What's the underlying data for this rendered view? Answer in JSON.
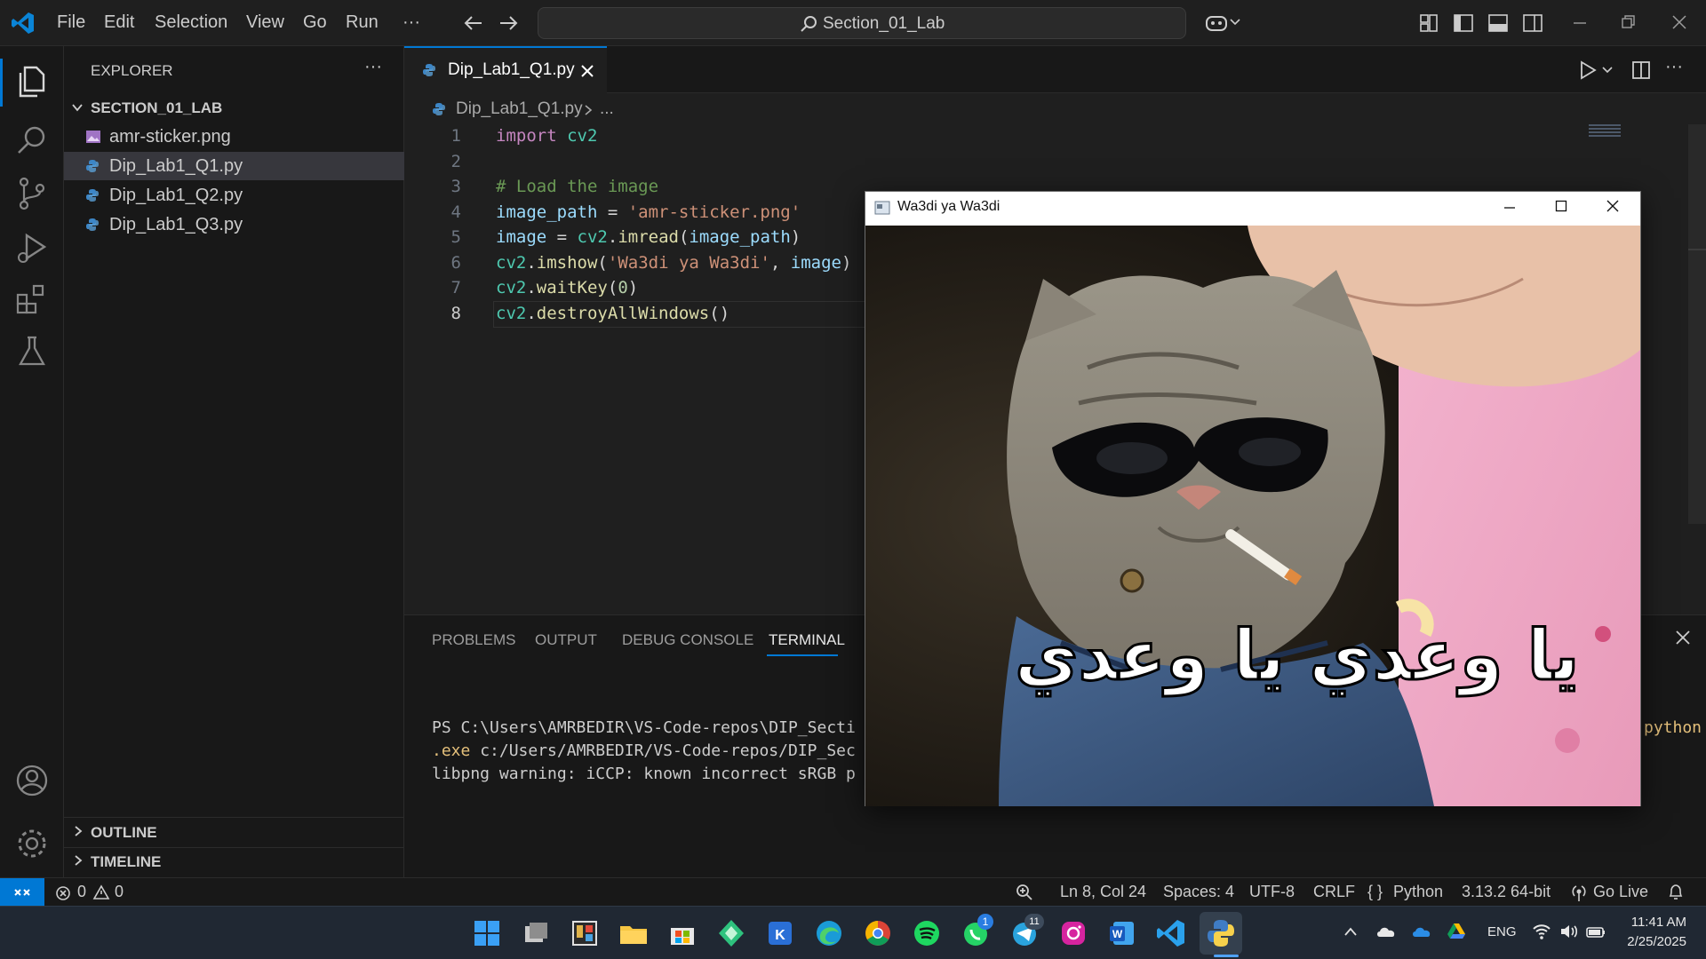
{
  "titlebar": {
    "menu": [
      "File",
      "Edit",
      "Selection",
      "View",
      "Go",
      "Run"
    ],
    "overflow": "···",
    "search_text": "Section_01_Lab"
  },
  "sidebar": {
    "title": "EXPLORER",
    "more": "···",
    "folder": "SECTION_01_LAB",
    "files": [
      "amr-sticker.png",
      "Dip_Lab1_Q1.py",
      "Dip_Lab1_Q2.py",
      "Dip_Lab1_Q3.py"
    ],
    "outline": "OUTLINE",
    "timeline": "TIMELINE"
  },
  "editor": {
    "tab_label": "Dip_Lab1_Q1.py",
    "breadcrumb_file": "Dip_Lab1_Q1.py",
    "breadcrumb_more": "...",
    "line_numbers": [
      "1",
      "2",
      "3",
      "4",
      "5",
      "6",
      "7",
      "8"
    ],
    "code": {
      "l1_kw": "import",
      "l1_mod": " cv2",
      "l3_comment": "# Load the image",
      "l4_var": "image_path",
      "l4_eq": " = ",
      "l4_str": "'amr-sticker.png'",
      "l5_var": "image",
      "l5_eq": " = ",
      "l5_mod": "cv2",
      "l5_dot": ".",
      "l5_fn": "imread",
      "l5_open": "(",
      "l5_arg": "image_path",
      "l5_close": ")",
      "l6_mod": "cv2",
      "l6_dot": ".",
      "l6_fn": "imshow",
      "l6_open": "(",
      "l6_str": "'Wa3di ya Wa3di'",
      "l6_comma": ", ",
      "l6_arg": "image",
      "l6_close": ")",
      "l7_mod": "cv2",
      "l7_dot": ".",
      "l7_fn": "waitKey",
      "l7_open": "(",
      "l7_num": "0",
      "l7_close": ")",
      "l8_mod": "cv2",
      "l8_dot": ".",
      "l8_fn": "destroyAllWindows",
      "l8_paren": "()"
    }
  },
  "panel": {
    "tabs": [
      "PROBLEMS",
      "OUTPUT",
      "DEBUG CONSOLE",
      "TERMINAL"
    ],
    "active_tab": "TERMINAL",
    "terminal_lines": [
      "PS C:\\Users\\AMRBEDIR\\VS-Code-repos\\DIP_Secti",
      "c:/Users/AMRBEDIR/VS-Code-repos/DIP_Sec",
      "libpng warning: iCCP: known incorrect sRGB p"
    ],
    "terminal_exe": ".exe",
    "terminal_side": "python"
  },
  "cv_window": {
    "title": "Wa3di ya Wa3di",
    "caption": "يا وعدي يا وعدي"
  },
  "statusbar": {
    "errors": "0",
    "warnings": "0",
    "cursor": "Ln 8, Col 24",
    "spaces": "Spaces: 4",
    "encoding": "UTF-8",
    "eol": "CRLF",
    "braces": "{ }",
    "language": "Python",
    "interpreter": "3.13.2 64-bit",
    "golive": "Go Live"
  },
  "taskbar": {
    "lang": "ENG",
    "time": "11:41 AM",
    "date": "2/25/2025",
    "badge_whatsapp": "1",
    "badge_telegram": "11"
  },
  "colors": {
    "accent": "#0078d4",
    "bg": "#1f1f1f",
    "sidebar": "#181818"
  }
}
